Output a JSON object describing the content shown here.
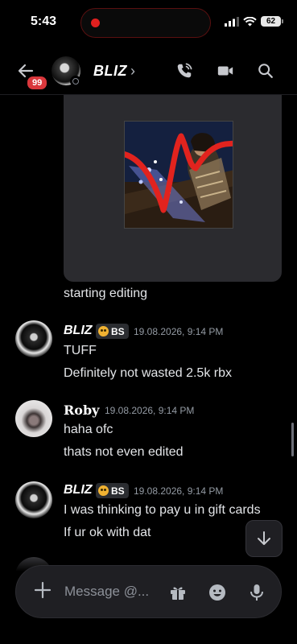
{
  "status_bar": {
    "time": "5:43",
    "battery": "62"
  },
  "header": {
    "title": "BLIZ",
    "unread_count": "99"
  },
  "attachment_caption": "starting editing",
  "messages": [
    {
      "author": "BLIZ",
      "tag": "BS",
      "timestamp": "19.08.2026, 9:14 PM",
      "lines": [
        "TUFF",
        "Definitely not wasted 2.5k rbx"
      ]
    },
    {
      "author": "Roby",
      "timestamp": "19.08.2026, 9:14 PM",
      "lines": [
        "haha ofc",
        "thats not even edited"
      ]
    },
    {
      "author": "BLIZ",
      "tag": "BS",
      "timestamp": "19.08.2026, 9:14 PM",
      "lines": [
        "I was thinking to pay u in gift cards",
        "If ur ok with dat"
      ]
    }
  ],
  "composer": {
    "placeholder": "Message @..."
  },
  "colors": {
    "background": "#000000",
    "unread_badge": "#da373c",
    "tag_bg": "#2b2d31",
    "timestamp": "#949ba4"
  },
  "icons": [
    "back-arrow-icon",
    "phone-call-icon",
    "video-camera-icon",
    "search-icon",
    "plus-icon",
    "gift-icon",
    "emoji-icon",
    "microphone-icon",
    "arrow-down-icon"
  ]
}
